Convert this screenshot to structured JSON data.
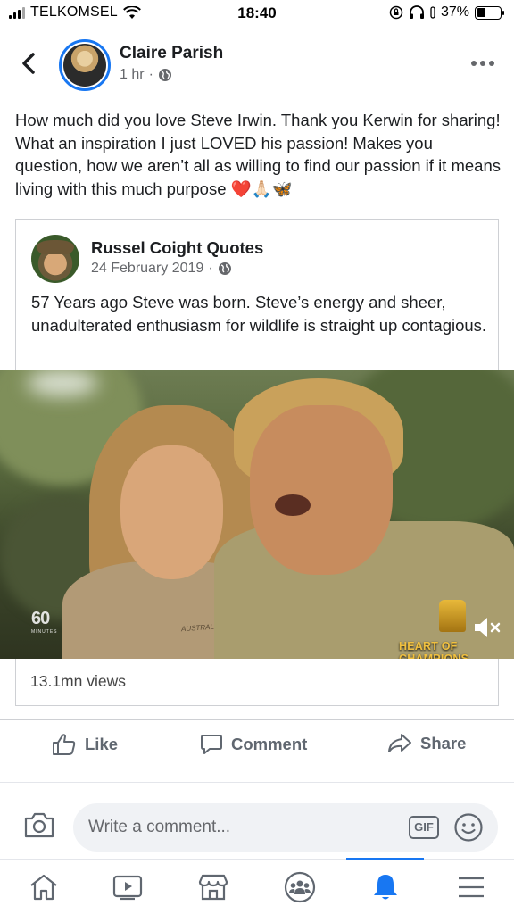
{
  "status_bar": {
    "carrier": "TELKOMSEL",
    "time": "18:40",
    "battery": "37%",
    "battery_level": 0.37
  },
  "post": {
    "author": "Claire Parish",
    "time": "1 hr",
    "separator": "·",
    "text": "How much did you love Steve Irwin. Thank you Kerwin for sharing! What an inspiration I just LOVED his passion! Makes you question, how we aren’t all as willing to find our passion if it means living with this much purpose ❤️🙏🏻🦋"
  },
  "shared": {
    "author": "Russel Coight Quotes",
    "date": "24 February 2019",
    "separator": "·",
    "text": "57 Years ago Steve was born. Steve’s energy and sheer, unadulterated enthusiasm for wildlife is straight up contagious.",
    "views": "13.1mn views",
    "video": {
      "logo": "60",
      "logo_sub": "MINUTES",
      "shirt_label": "AUSTRALIA ZOO",
      "badge": "HEART OF CHAMPIONS"
    }
  },
  "actions": {
    "like": "Like",
    "comment": "Comment",
    "share": "Share"
  },
  "comment_bar": {
    "placeholder": "Write a comment...",
    "gif": "GIF"
  },
  "colors": {
    "accent": "#1877f2",
    "secondary_text": "#65676b",
    "border": "#ced0d4"
  }
}
